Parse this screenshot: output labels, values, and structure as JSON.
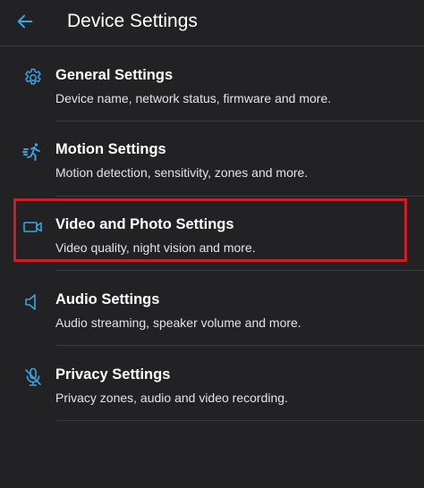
{
  "header": {
    "title": "Device Settings",
    "back_icon": "arrow-left-icon"
  },
  "colors": {
    "background": "#222225",
    "accent": "#3da3e0",
    "highlight": "#cc1e29",
    "divider": "#3a3a3d"
  },
  "settings": [
    {
      "title": "General Settings",
      "subtitle": "Device name, network status, firmware and more.",
      "icon": "gear-icon"
    },
    {
      "title": "Motion Settings",
      "subtitle": "Motion detection, sensitivity, zones and more.",
      "icon": "running-person-icon"
    },
    {
      "title": "Video and Photo Settings",
      "subtitle": "Video quality, night vision and more.",
      "icon": "video-camera-icon"
    },
    {
      "title": "Audio Settings",
      "subtitle": "Audio streaming, speaker volume and more.",
      "icon": "speaker-icon"
    },
    {
      "title": "Privacy Settings",
      "subtitle": "Privacy zones, audio and video recording.",
      "icon": "microphone-off-icon"
    }
  ]
}
